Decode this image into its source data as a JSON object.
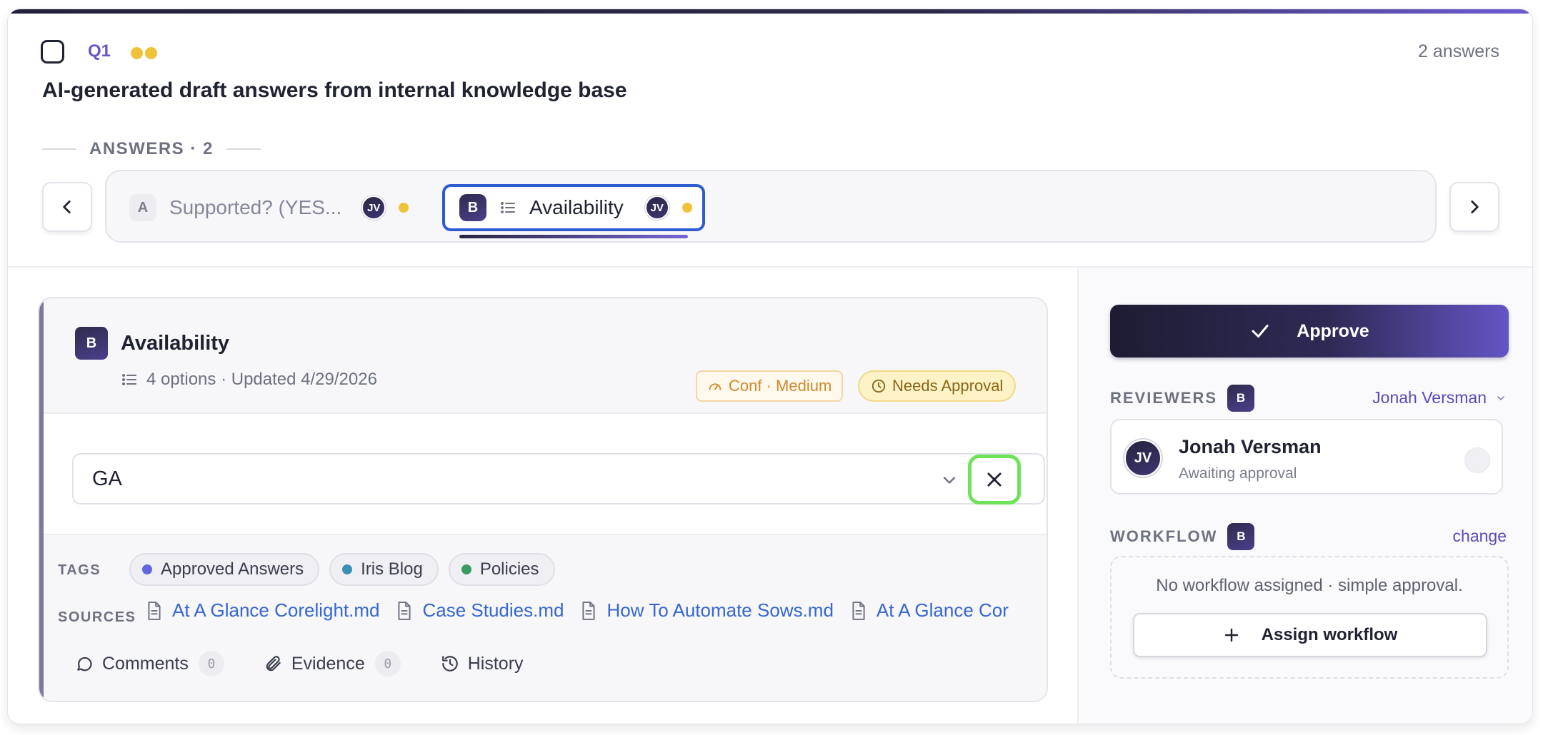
{
  "question": {
    "number": "Q1",
    "answer_count": "2 answers",
    "title": "AI-generated draft answers from internal knowledge base"
  },
  "answers_divider": "ANSWERS · 2",
  "tabs": [
    {
      "badge": "A",
      "label": "Supported? (YES...",
      "avatar": "JV"
    },
    {
      "badge": "B",
      "label": "Availability",
      "avatar": "JV"
    }
  ],
  "answer": {
    "badge": "B",
    "title": "Availability",
    "meta": "4 options · Updated 4/29/2026",
    "confidence": "Conf · Medium",
    "status": "Needs Approval",
    "selected_value": "GA",
    "tags_label": "TAGS",
    "tags": [
      {
        "label": "Approved Answers",
        "color": "#6366e0"
      },
      {
        "label": "Iris Blog",
        "color": "#3a8fb7"
      },
      {
        "label": "Policies",
        "color": "#3a9a63"
      }
    ],
    "sources_label": "SOURCES",
    "sources": [
      "At A Glance Corelight.md",
      "Case Studies.md",
      "How To Automate Sows.md",
      "At A Glance Cor"
    ],
    "actions": [
      {
        "label": "Comments",
        "count": "0"
      },
      {
        "label": "Evidence",
        "count": "0"
      },
      {
        "label": "History"
      }
    ]
  },
  "panel": {
    "approve_label": "Approve",
    "reviewers_label": "REVIEWERS",
    "reviewers_badge": "B",
    "reviewer_select": "Jonah Versman",
    "reviewer": {
      "initials": "JV",
      "name": "Jonah Versman",
      "status": "Awaiting approval"
    },
    "workflow_label": "WORKFLOW",
    "workflow_badge": "B",
    "workflow_change": "change",
    "workflow_text": "No workflow assigned · simple approval.",
    "assign_label": "Assign workflow"
  },
  "colors": {
    "accent": "#6a55c8",
    "highlight": "#6ee35a",
    "tab_focus": "#2d5bd0"
  }
}
